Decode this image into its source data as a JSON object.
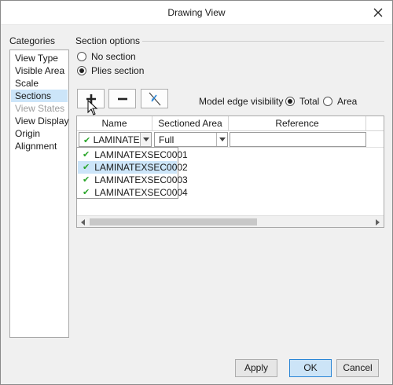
{
  "window": {
    "title": "Drawing View",
    "close_icon": "close-icon"
  },
  "categories": {
    "heading": "Categories",
    "items": [
      {
        "label": "View Type",
        "state": "normal"
      },
      {
        "label": "Visible Area",
        "state": "normal"
      },
      {
        "label": "Scale",
        "state": "normal"
      },
      {
        "label": "Sections",
        "state": "selected"
      },
      {
        "label": "View States",
        "state": "disabled"
      },
      {
        "label": "View Display",
        "state": "normal"
      },
      {
        "label": "Origin",
        "state": "normal"
      },
      {
        "label": "Alignment",
        "state": "normal"
      }
    ]
  },
  "section_options": {
    "heading": "Section options",
    "radios": [
      {
        "label": "No section",
        "checked": false
      },
      {
        "label": "Plies section",
        "checked": true
      }
    ]
  },
  "toolbar": {
    "add_icon": "plus-icon",
    "remove_icon": "minus-icon",
    "flip_icon": "flip-arrow-icon"
  },
  "edge_visibility": {
    "label": "Model edge visibility",
    "options": [
      {
        "label": "Total",
        "checked": true
      },
      {
        "label": "Area",
        "checked": false
      }
    ]
  },
  "table": {
    "columns": [
      "Name",
      "Sectioned Area",
      "Reference"
    ],
    "row": {
      "name": "LAMINATE:",
      "sectioned_area": "Full",
      "reference": ""
    }
  },
  "dropdown": {
    "items": [
      {
        "label": "LAMINATEXSEC0001",
        "selected": false
      },
      {
        "label": "LAMINATEXSEC0002",
        "selected": true
      },
      {
        "label": "LAMINATEXSEC0003",
        "selected": false
      },
      {
        "label": "LAMINATEXSEC0004",
        "selected": false
      }
    ]
  },
  "buttons": {
    "apply": "Apply",
    "ok": "OK",
    "cancel": "Cancel"
  },
  "colors": {
    "accent": "#2b86d6",
    "selection": "#cce5f9",
    "check": "#2aa52a"
  }
}
